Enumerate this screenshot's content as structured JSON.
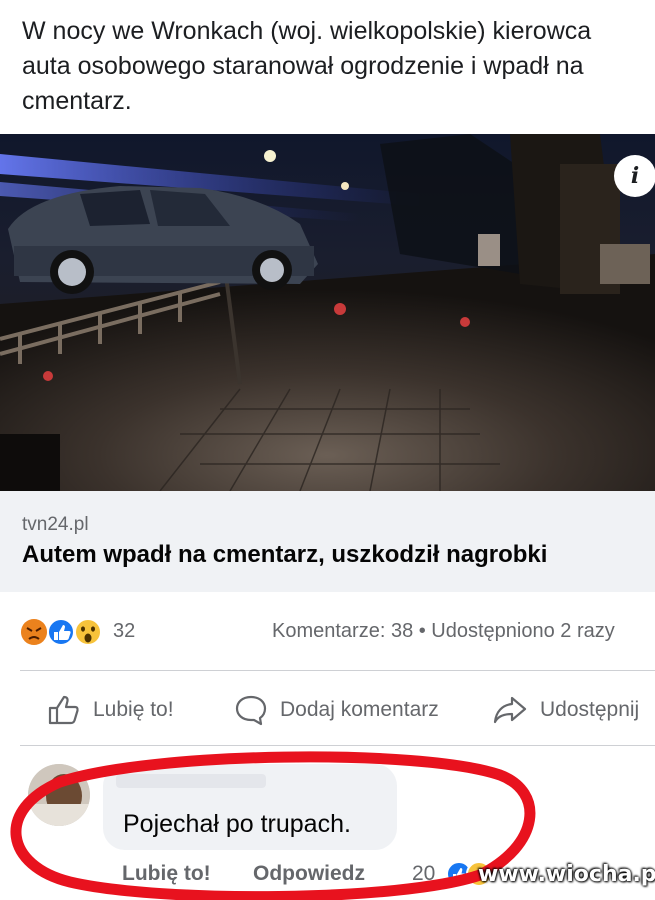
{
  "post": {
    "text_lines": [
      "W nocy we Wronkach (woj. wielkopolskie) kierowca",
      "auta osobowego staranował ogrodzenie i wpadł na",
      "cmentarz."
    ]
  },
  "photo": {
    "info_icon": "i"
  },
  "link_preview": {
    "source": "tvn24.pl",
    "title": "Autem wpadł na cmentarz, uszkodził nagrobki"
  },
  "reactions": {
    "icons": [
      "angry-icon",
      "like-icon",
      "wow-icon"
    ],
    "count": "32",
    "stats": "Komentarze: 38 • Udostępniono 2 razy"
  },
  "actions": {
    "like": "Lubię to!",
    "comment": "Dodaj komentarz",
    "share": "Udostępnij"
  },
  "comment": {
    "text": "Pojechał po trupach.",
    "like": "Lubię to!",
    "reply": "Odpowiedz",
    "reaction_count": "20"
  },
  "watermark": "www.wiocha.pl",
  "colors": {
    "annotation": "#e8121e",
    "like_blue": "#1877f2",
    "secondary_text": "#65676b"
  }
}
